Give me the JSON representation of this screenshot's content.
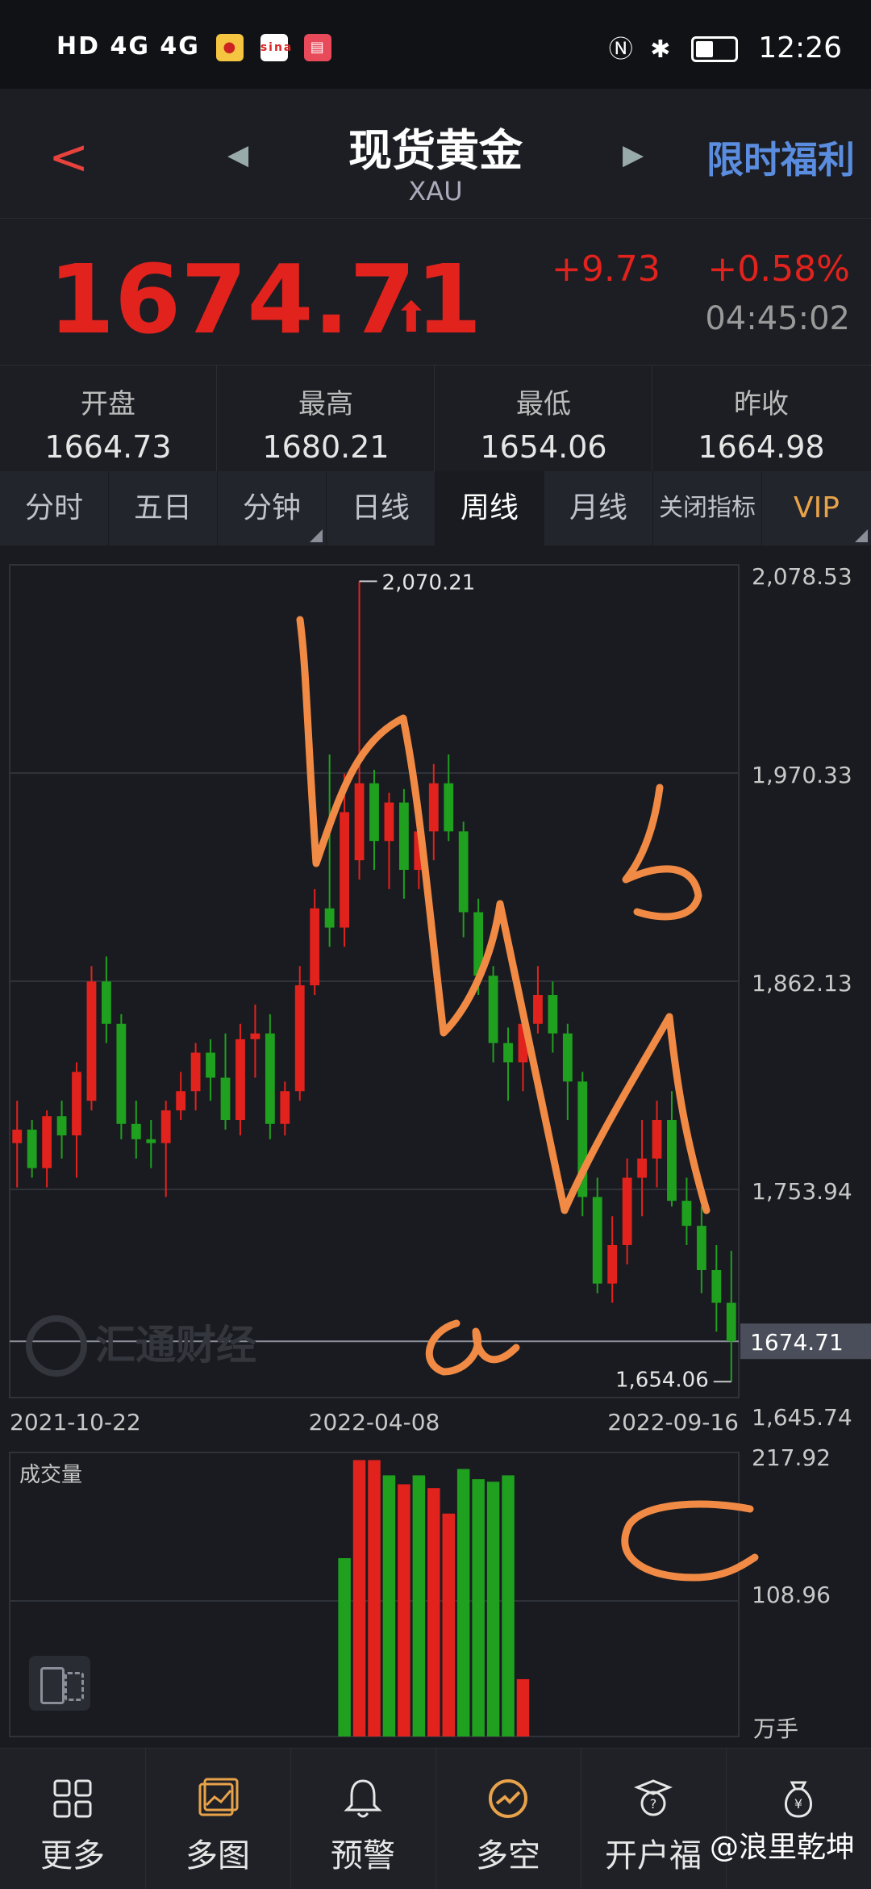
{
  "status_bar": {
    "network": "HD 4G 4G",
    "time": "12:26",
    "icons": [
      "signal-icon",
      "wifi-icon",
      "heart-icon",
      "weibo-icon",
      "sina-icon",
      "book-icon",
      "nfc-icon",
      "bluetooth-icon",
      "battery-icon"
    ],
    "sina_label": "sina"
  },
  "header": {
    "title": "现货黄金",
    "subtitle": "XAU",
    "promo": "限时福利"
  },
  "price": {
    "last": "1674.71",
    "change": "+9.73",
    "change_pct": "+0.58%",
    "time": "04:45:02"
  },
  "stats": [
    {
      "label": "开盘",
      "value": "1664.73"
    },
    {
      "label": "最高",
      "value": "1680.21"
    },
    {
      "label": "最低",
      "value": "1654.06"
    },
    {
      "label": "昨收",
      "value": "1664.98"
    }
  ],
  "tabs": [
    {
      "label": "分时",
      "corner": false
    },
    {
      "label": "五日",
      "corner": false
    },
    {
      "label": "分钟",
      "corner": true
    },
    {
      "label": "日线",
      "corner": false
    },
    {
      "label": "周线",
      "corner": false,
      "active": true
    },
    {
      "label": "月线",
      "corner": false
    },
    {
      "label": "关闭指标",
      "corner": false
    },
    {
      "label": "VIP",
      "corner": true
    }
  ],
  "chart_data": {
    "type": "candlestick",
    "ylim": [
      1645.74,
      2078.53
    ],
    "y_ticks": [
      "2,078.53",
      "1,970.33",
      "1,862.13",
      "1,753.94",
      "1,645.74"
    ],
    "x_labels": [
      "2021-10-22",
      "2022-04-08",
      "2022-09-16"
    ],
    "last_price_label": "1674.71",
    "high_label": "2,070.21",
    "low_label": "1,654.06",
    "watermark": "汇通财经",
    "up_color": "#e2221d",
    "down_color": "#1fa01f",
    "candles": [
      {
        "o": 1778,
        "h": 1800,
        "l": 1755,
        "c": 1785
      },
      {
        "o": 1785,
        "h": 1790,
        "l": 1760,
        "c": 1765
      },
      {
        "o": 1765,
        "h": 1795,
        "l": 1755,
        "c": 1792
      },
      {
        "o": 1792,
        "h": 1800,
        "l": 1770,
        "c": 1782
      },
      {
        "o": 1782,
        "h": 1820,
        "l": 1760,
        "c": 1815
      },
      {
        "o": 1800,
        "h": 1870,
        "l": 1795,
        "c": 1862
      },
      {
        "o": 1862,
        "h": 1875,
        "l": 1830,
        "c": 1840
      },
      {
        "o": 1840,
        "h": 1845,
        "l": 1780,
        "c": 1788
      },
      {
        "o": 1788,
        "h": 1800,
        "l": 1770,
        "c": 1780
      },
      {
        "o": 1780,
        "h": 1790,
        "l": 1765,
        "c": 1778
      },
      {
        "o": 1778,
        "h": 1800,
        "l": 1750,
        "c": 1795
      },
      {
        "o": 1795,
        "h": 1815,
        "l": 1790,
        "c": 1805
      },
      {
        "o": 1805,
        "h": 1830,
        "l": 1795,
        "c": 1825
      },
      {
        "o": 1825,
        "h": 1832,
        "l": 1800,
        "c": 1812
      },
      {
        "o": 1812,
        "h": 1835,
        "l": 1785,
        "c": 1790
      },
      {
        "o": 1790,
        "h": 1840,
        "l": 1782,
        "c": 1832
      },
      {
        "o": 1832,
        "h": 1850,
        "l": 1812,
        "c": 1835
      },
      {
        "o": 1835,
        "h": 1845,
        "l": 1780,
        "c": 1788
      },
      {
        "o": 1788,
        "h": 1810,
        "l": 1782,
        "c": 1805
      },
      {
        "o": 1805,
        "h": 1870,
        "l": 1800,
        "c": 1860
      },
      {
        "o": 1860,
        "h": 1910,
        "l": 1855,
        "c": 1900
      },
      {
        "o": 1900,
        "h": 1980,
        "l": 1880,
        "c": 1890
      },
      {
        "o": 1890,
        "h": 1970,
        "l": 1880,
        "c": 1950
      },
      {
        "o": 1925,
        "h": 2070,
        "l": 1915,
        "c": 1965
      },
      {
        "o": 1965,
        "h": 1972,
        "l": 1920,
        "c": 1935
      },
      {
        "o": 1935,
        "h": 1960,
        "l": 1910,
        "c": 1955
      },
      {
        "o": 1955,
        "h": 1962,
        "l": 1905,
        "c": 1920
      },
      {
        "o": 1920,
        "h": 1945,
        "l": 1910,
        "c": 1940
      },
      {
        "o": 1940,
        "h": 1975,
        "l": 1925,
        "c": 1965
      },
      {
        "o": 1965,
        "h": 1980,
        "l": 1935,
        "c": 1940
      },
      {
        "o": 1940,
        "h": 1945,
        "l": 1885,
        "c": 1898
      },
      {
        "o": 1898,
        "h": 1905,
        "l": 1855,
        "c": 1865
      },
      {
        "o": 1865,
        "h": 1870,
        "l": 1820,
        "c": 1830
      },
      {
        "o": 1830,
        "h": 1838,
        "l": 1800,
        "c": 1820
      },
      {
        "o": 1820,
        "h": 1845,
        "l": 1805,
        "c": 1840
      },
      {
        "o": 1840,
        "h": 1870,
        "l": 1835,
        "c": 1855
      },
      {
        "o": 1855,
        "h": 1862,
        "l": 1825,
        "c": 1835
      },
      {
        "o": 1835,
        "h": 1840,
        "l": 1790,
        "c": 1810
      },
      {
        "o": 1810,
        "h": 1815,
        "l": 1740,
        "c": 1750
      },
      {
        "o": 1750,
        "h": 1760,
        "l": 1700,
        "c": 1705
      },
      {
        "o": 1705,
        "h": 1740,
        "l": 1695,
        "c": 1725
      },
      {
        "o": 1725,
        "h": 1770,
        "l": 1715,
        "c": 1760
      },
      {
        "o": 1760,
        "h": 1790,
        "l": 1740,
        "c": 1770
      },
      {
        "o": 1770,
        "h": 1800,
        "l": 1755,
        "c": 1790
      },
      {
        "o": 1790,
        "h": 1805,
        "l": 1745,
        "c": 1748
      },
      {
        "o": 1748,
        "h": 1760,
        "l": 1725,
        "c": 1735
      },
      {
        "o": 1735,
        "h": 1745,
        "l": 1700,
        "c": 1712
      },
      {
        "o": 1712,
        "h": 1725,
        "l": 1680,
        "c": 1695
      },
      {
        "o": 1695,
        "h": 1722,
        "l": 1654,
        "c": 1675
      }
    ],
    "volume": {
      "label": "成交量",
      "ylim": [
        0,
        217.92
      ],
      "y_ticks": [
        "217.92",
        "108.96"
      ],
      "unit": "万手",
      "bars": [
        {
          "v": 140,
          "up": false
        },
        {
          "v": 217,
          "up": true
        },
        {
          "v": 217,
          "up": true
        },
        {
          "v": 205,
          "up": false
        },
        {
          "v": 198,
          "up": true
        },
        {
          "v": 205,
          "up": false
        },
        {
          "v": 195,
          "up": true
        },
        {
          "v": 175,
          "up": true
        },
        {
          "v": 210,
          "up": false
        },
        {
          "v": 202,
          "up": false
        },
        {
          "v": 200,
          "up": false
        },
        {
          "v": 205,
          "up": false
        },
        {
          "v": 45,
          "up": true
        }
      ]
    },
    "annotations": [
      "a",
      "b",
      "c"
    ]
  },
  "bottom_nav": [
    {
      "label": "更多",
      "icon": "grid-icon"
    },
    {
      "label": "多图",
      "icon": "multi-chart-icon"
    },
    {
      "label": "预警",
      "icon": "bell-icon"
    },
    {
      "label": "多空",
      "icon": "trend-icon"
    },
    {
      "label": "开户福",
      "icon": "gift-icon"
    },
    {
      "label": "",
      "icon": "money-bag-icon"
    }
  ],
  "watermark_user": "@浪里乾坤"
}
